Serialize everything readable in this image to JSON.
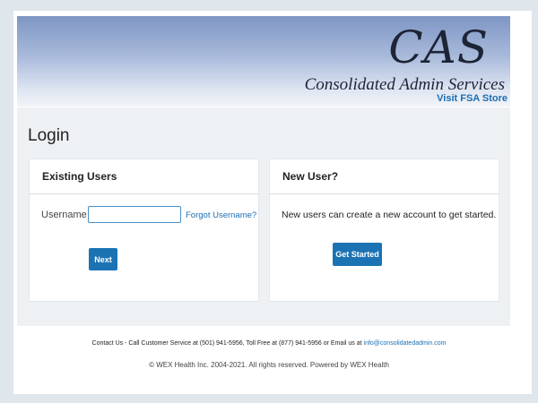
{
  "header": {
    "logo_text": "CAS",
    "logo_subtitle": "Consolidated Admin Services",
    "fsa_link": "Visit FSA Store"
  },
  "page": {
    "title": "Login"
  },
  "existing_users": {
    "title": "Existing Users",
    "username_label": "Username",
    "username_value": "",
    "forgot_link": "Forgot Username?",
    "next_button": "Next"
  },
  "new_user": {
    "title": "New User?",
    "description": "New users can create a new account to get started.",
    "get_started_button": "Get Started"
  },
  "footer": {
    "contact_text": "Contact Us - Call Customer Service at (501) 941-5956, Toll Free at (877) 941-5956 or Email us at ",
    "contact_email": "info@consolidatedadmin.com",
    "copyright": "© WEX Health Inc. 2004-2021. All rights reserved. Powered by WEX Health"
  },
  "colors": {
    "accent": "#1b73b3",
    "link": "#1a6eb2",
    "banner_top": "#7e96c4",
    "content_background": "#eef1f4"
  }
}
